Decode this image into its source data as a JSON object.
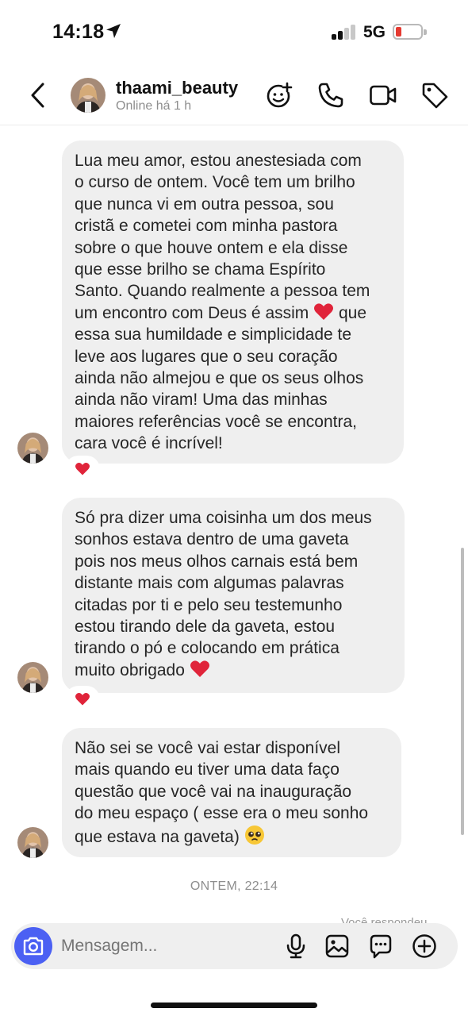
{
  "status_bar": {
    "time": "14:18",
    "network": "5G",
    "battery_level": 0.15
  },
  "header": {
    "username": "thaami_beauty",
    "presence": "Online há 1 h"
  },
  "messages": [
    {
      "lines": [
        "Lua meu amor, estou anestesiada com",
        "o curso de ontem. Você tem um brilho",
        "que nunca vi em outra pessoa, sou",
        "cristã e cometei com minha pastora",
        "sobre o que houve ontem e ela disse",
        "que esse brilho se chama Espírito",
        "Santo. Quando realmente a pessoa tem",
        "um encontro com Deus é assim",
        "essa sua humildade e simplicidade te",
        "leve aos lugares que o seu coração",
        "ainda não almejou e que os seus olhos",
        "ainda não viram! Uma das minhas",
        "maiores referências você se encontra,",
        "cara você é incrível!"
      ],
      "line7_tail": "que",
      "reaction": "heart"
    },
    {
      "lines": [
        "Só pra dizer uma coisinha um dos meus",
        "sonhos estava dentro de uma gaveta",
        "pois nos meus olhos carnais está bem",
        "distante mais com algumas palavras",
        "citadas por ti e pelo seu testemunho",
        "estou tirando dele da gaveta, estou",
        "tirando o pó e colocando em prática",
        "muito obrigado"
      ],
      "reaction": "heart"
    },
    {
      "lines": [
        "Não sei se você vai estar disponível",
        "mais quando eu tiver uma data faço",
        "questão que você vai na inauguração",
        "do meu espaço ( esse era o meu sonho",
        "que estava na gaveta)"
      ],
      "emoji": "pleading-face"
    }
  ],
  "timestamp": "ONTEM, 22:14",
  "seen_hint": "Você respondeu",
  "composer": {
    "placeholder": "Mensagem..."
  },
  "icons": {
    "back": "chevron-left-icon",
    "effects": "sparkle-face-icon",
    "call": "phone-icon",
    "video": "video-camera-icon",
    "tag": "tag-icon",
    "camera": "camera-icon",
    "mic": "microphone-icon",
    "gallery": "image-icon",
    "sticker": "chat-bubble-icon",
    "add": "plus-circle-icon"
  },
  "colors": {
    "accent": "#4b60f3",
    "bubble": "#efefef",
    "heart": "#e0243a",
    "battery_low": "#e53a31"
  }
}
